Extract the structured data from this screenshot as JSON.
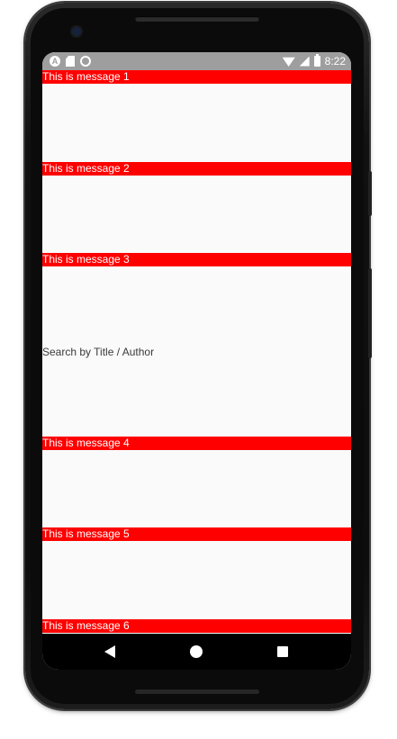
{
  "status_bar": {
    "time": "8:22",
    "left_icons": [
      "android-notification-icon",
      "sd-card-icon",
      "sync-ring-icon"
    ],
    "right_icons": [
      "wifi-icon",
      "cell-signal-icon",
      "battery-icon"
    ]
  },
  "messages": [
    {
      "label": "This is message 1"
    },
    {
      "label": "This is message 2"
    },
    {
      "label": "This is message 3"
    },
    {
      "label": "This is message 4"
    },
    {
      "label": "This is message 5"
    },
    {
      "label": "This is message 6"
    }
  ],
  "search": {
    "label": "Search by Title / Author"
  },
  "nav_bar": {
    "buttons": [
      "back-icon",
      "home-icon",
      "recents-icon"
    ]
  },
  "colors": {
    "message_bar": "#ff0000",
    "status_bar": "#9e9e9e",
    "screen_background": "#fafafa",
    "nav_bar": "#000000"
  }
}
